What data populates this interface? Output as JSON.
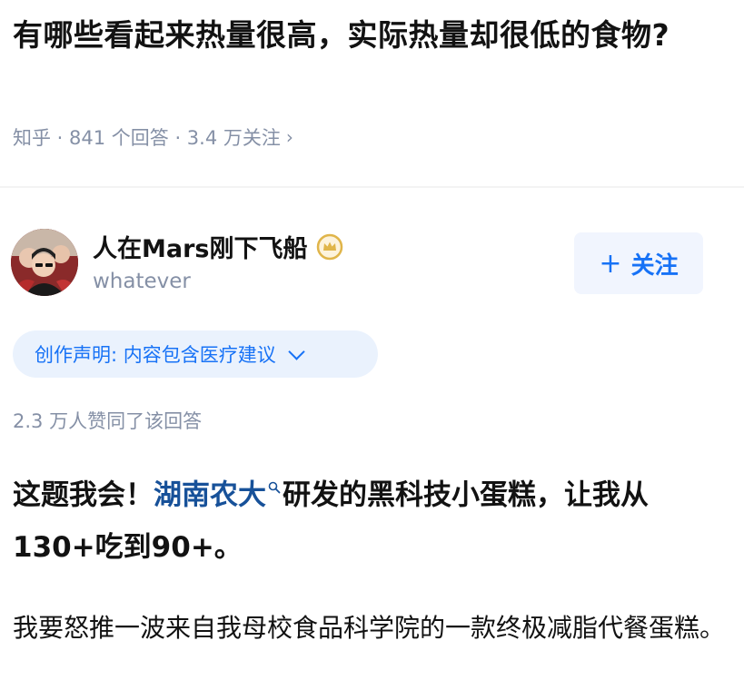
{
  "question": {
    "title": "有哪些看起来热量很高，实际热量却很低的食物?",
    "meta": "知乎 · 841 个回答 · 3.4 万关注"
  },
  "author": {
    "name": "人在Mars刚下飞船",
    "headline": "whatever",
    "follow_label": "关注"
  },
  "declaration": {
    "label": "创作声明: 内容包含医疗建议"
  },
  "answer": {
    "vote_text": "2.3 万人赞同了该回答",
    "lead_before": "这题我会！",
    "lead_link": "湖南农大",
    "lead_after": "研发的黑科技小蛋糕，让我从130+吃到90+。",
    "body": "我要怒推一波来自我母校食品科学院的一款终极减脂代餐蛋糕。"
  },
  "colors": {
    "accent": "#1772f6",
    "link": "#175199",
    "muted": "#8590a6",
    "badge": "#e0b54a"
  },
  "icons": {
    "meta_chevron": "chevron-right-icon",
    "badge": "crown-badge-icon",
    "follow": "plus-icon",
    "declaration": "chevron-down-icon",
    "link_search": "search-icon"
  }
}
